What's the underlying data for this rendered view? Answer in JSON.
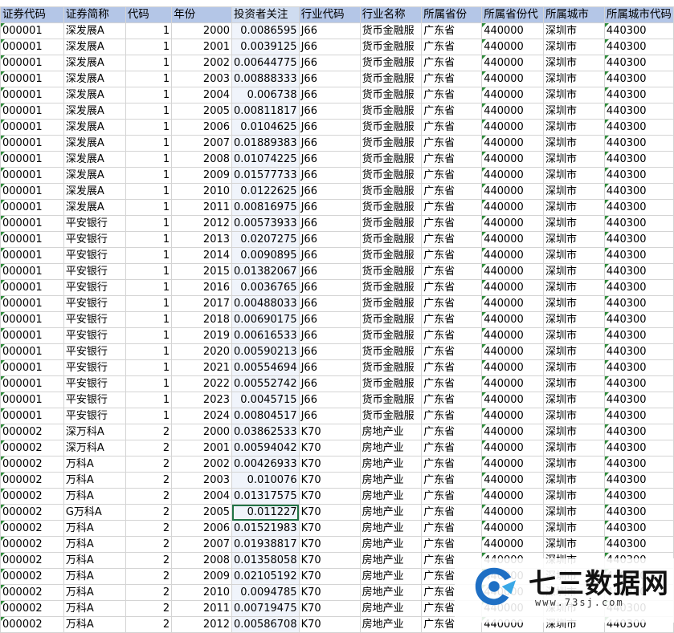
{
  "columns": [
    "证券代码",
    "证券简称",
    "代码",
    "年份",
    "投资者关注",
    "行业代码",
    "行业名称",
    "所属省份",
    "所属省份代",
    "所属城市",
    "所属城市代码"
  ],
  "rows": [
    [
      "000001",
      "深发展A",
      "1",
      "2000",
      "0.0086595",
      "J66",
      "货币金融服",
      "广东省",
      "440000",
      "深圳市",
      "440300"
    ],
    [
      "000001",
      "深发展A",
      "1",
      "2001",
      "0.0039125",
      "J66",
      "货币金融服",
      "广东省",
      "440000",
      "深圳市",
      "440300"
    ],
    [
      "000001",
      "深发展A",
      "1",
      "2002",
      "0.00644775",
      "J66",
      "货币金融服",
      "广东省",
      "440000",
      "深圳市",
      "440300"
    ],
    [
      "000001",
      "深发展A",
      "1",
      "2003",
      "0.00888333",
      "J66",
      "货币金融服",
      "广东省",
      "440000",
      "深圳市",
      "440300"
    ],
    [
      "000001",
      "深发展A",
      "1",
      "2004",
      "0.006738",
      "J66",
      "货币金融服",
      "广东省",
      "440000",
      "深圳市",
      "440300"
    ],
    [
      "000001",
      "深发展A",
      "1",
      "2005",
      "0.00811817",
      "J66",
      "货币金融服",
      "广东省",
      "440000",
      "深圳市",
      "440300"
    ],
    [
      "000001",
      "深发展A",
      "1",
      "2006",
      "0.0104625",
      "J66",
      "货币金融服",
      "广东省",
      "440000",
      "深圳市",
      "440300"
    ],
    [
      "000001",
      "深发展A",
      "1",
      "2007",
      "0.01889383",
      "J66",
      "货币金融服",
      "广东省",
      "440000",
      "深圳市",
      "440300"
    ],
    [
      "000001",
      "深发展A",
      "1",
      "2008",
      "0.01074225",
      "J66",
      "货币金融服",
      "广东省",
      "440000",
      "深圳市",
      "440300"
    ],
    [
      "000001",
      "深发展A",
      "1",
      "2009",
      "0.01577733",
      "J66",
      "货币金融服",
      "广东省",
      "440000",
      "深圳市",
      "440300"
    ],
    [
      "000001",
      "深发展A",
      "1",
      "2010",
      "0.0122625",
      "J66",
      "货币金融服",
      "广东省",
      "440000",
      "深圳市",
      "440300"
    ],
    [
      "000001",
      "深发展A",
      "1",
      "2011",
      "0.00816975",
      "J66",
      "货币金融服",
      "广东省",
      "440000",
      "深圳市",
      "440300"
    ],
    [
      "000001",
      "平安银行",
      "1",
      "2012",
      "0.00573933",
      "J66",
      "货币金融服",
      "广东省",
      "440000",
      "深圳市",
      "440300"
    ],
    [
      "000001",
      "平安银行",
      "1",
      "2013",
      "0.0207275",
      "J66",
      "货币金融服",
      "广东省",
      "440000",
      "深圳市",
      "440300"
    ],
    [
      "000001",
      "平安银行",
      "1",
      "2014",
      "0.0090895",
      "J66",
      "货币金融服",
      "广东省",
      "440000",
      "深圳市",
      "440300"
    ],
    [
      "000001",
      "平安银行",
      "1",
      "2015",
      "0.01382067",
      "J66",
      "货币金融服",
      "广东省",
      "440000",
      "深圳市",
      "440300"
    ],
    [
      "000001",
      "平安银行",
      "1",
      "2016",
      "0.0036765",
      "J66",
      "货币金融服",
      "广东省",
      "440000",
      "深圳市",
      "440300"
    ],
    [
      "000001",
      "平安银行",
      "1",
      "2017",
      "0.00488033",
      "J66",
      "货币金融服",
      "广东省",
      "440000",
      "深圳市",
      "440300"
    ],
    [
      "000001",
      "平安银行",
      "1",
      "2018",
      "0.00690175",
      "J66",
      "货币金融服",
      "广东省",
      "440000",
      "深圳市",
      "440300"
    ],
    [
      "000001",
      "平安银行",
      "1",
      "2019",
      "0.00616533",
      "J66",
      "货币金融服",
      "广东省",
      "440000",
      "深圳市",
      "440300"
    ],
    [
      "000001",
      "平安银行",
      "1",
      "2020",
      "0.00590213",
      "J66",
      "货币金融服",
      "广东省",
      "440000",
      "深圳市",
      "440300"
    ],
    [
      "000001",
      "平安银行",
      "1",
      "2021",
      "0.00554694",
      "J66",
      "货币金融服",
      "广东省",
      "440000",
      "深圳市",
      "440300"
    ],
    [
      "000001",
      "平安银行",
      "1",
      "2022",
      "0.00552742",
      "J66",
      "货币金融服",
      "广东省",
      "440000",
      "深圳市",
      "440300"
    ],
    [
      "000001",
      "平安银行",
      "1",
      "2023",
      "0.0045715",
      "J66",
      "货币金融服",
      "广东省",
      "440000",
      "深圳市",
      "440300"
    ],
    [
      "000001",
      "平安银行",
      "1",
      "2024",
      "0.00804517",
      "J66",
      "货币金融服",
      "广东省",
      "440000",
      "深圳市",
      "440300"
    ],
    [
      "000002",
      "深万科A",
      "2",
      "2000",
      "0.03862533",
      "K70",
      "房地产业",
      "广东省",
      "440000",
      "深圳市",
      "440300"
    ],
    [
      "000002",
      "深万科A",
      "2",
      "2001",
      "0.00594042",
      "K70",
      "房地产业",
      "广东省",
      "440000",
      "深圳市",
      "440300"
    ],
    [
      "000002",
      "万科A",
      "2",
      "2002",
      "0.00426933",
      "K70",
      "房地产业",
      "广东省",
      "440000",
      "深圳市",
      "440300"
    ],
    [
      "000002",
      "万科A",
      "2",
      "2003",
      "0.010076",
      "K70",
      "房地产业",
      "广东省",
      "440000",
      "深圳市",
      "440300"
    ],
    [
      "000002",
      "万科A",
      "2",
      "2004",
      "0.01317575",
      "K70",
      "房地产业",
      "广东省",
      "440000",
      "深圳市",
      "440300"
    ],
    [
      "000002",
      "G万科A",
      "2",
      "2005",
      "0.011227",
      "K70",
      "房地产业",
      "广东省",
      "440000",
      "深圳市",
      "440300"
    ],
    [
      "000002",
      "万科A",
      "2",
      "2006",
      "0.01521983",
      "K70",
      "房地产业",
      "广东省",
      "440000",
      "深圳市",
      "440300"
    ],
    [
      "000002",
      "万科A",
      "2",
      "2007",
      "0.01938817",
      "K70",
      "房地产业",
      "广东省",
      "440000",
      "深圳市",
      "440300"
    ],
    [
      "000002",
      "万科A",
      "2",
      "2008",
      "0.01358058",
      "K70",
      "房地产业",
      "广东省",
      "440000",
      "深圳市",
      "440300"
    ],
    [
      "000002",
      "万科A",
      "2",
      "2009",
      "0.02105192",
      "K70",
      "房地产业",
      "广东省",
      "440000",
      "深圳市",
      "440300"
    ],
    [
      "000002",
      "万科A",
      "2",
      "2010",
      "0.0094785",
      "K70",
      "房地产业",
      "广东省",
      "440000",
      "深圳市",
      "440300"
    ],
    [
      "000002",
      "万科A",
      "2",
      "2011",
      "0.00719475",
      "K70",
      "房地产业",
      "广东省",
      "440000",
      "深圳市",
      "440300"
    ],
    [
      "000002",
      "万科A",
      "2",
      "2012",
      "0.00586708",
      "K70",
      "房地产业",
      "广东省",
      "440000",
      "深圳市",
      "440300"
    ]
  ],
  "numeric_columns": [
    2,
    3,
    4
  ],
  "selected_column": 4,
  "active_cell": {
    "row": 30,
    "col": 4
  },
  "watermark": {
    "title": "七三数据网",
    "url": "www.73sj.com"
  },
  "colors": {
    "header_bg": "#b4c6e7",
    "grid": "#d4d4d4",
    "selection": "#217346",
    "error_triangle": "#2e8b3a"
  }
}
